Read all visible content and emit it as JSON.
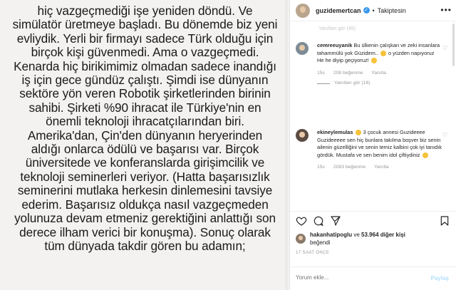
{
  "post": {
    "text_lines": [
      "hiç vazgeçmediği işe yeniden döndü. Ve",
      "simülatör üretmeye başladı. Bu dönemde biz yeni",
      "evliydik. Yerli bir firmayı sadece Türk olduğu için",
      "birçok kişi güvenmedi. Ama o vazgeçmedi.",
      "Kenarda hiç birikimimiz olmadan sadece inandığı",
      "iş için gece gündüz çalıştı. Şimdi ise dünyanın",
      "sektöre yön veren Robotik şirketlerinden birinin",
      "sahibi. Şirketi %90 ihracat ile Türkiye'nin en",
      "önemli teknoloji ihracatçılarından biri.",
      "Amerika'dan, Çin'den dünyanın heryerinden",
      "aldığı onlarca ödülü ve başarısı var. Birçok",
      "üniversitede ve konferanslarda girişimcilik ve",
      "teknoloji seminerleri veriyor. (Hatta başarısızlık",
      "seminerini mutlaka herkesin dinlemesini tavsiye",
      "ederim. Başarısız oldukça nasıl vazgeçmeden",
      "yolunuza devam etmeniz gerektiğini anlattığı son",
      "derece ilham verici bir konuşma). Sonuç olarak",
      "tüm dünyada takdir gören bu adamın;"
    ]
  },
  "header": {
    "username": "guzidemertcan",
    "separator": "•",
    "follow_status": "Takiptesin",
    "more": "•••"
  },
  "comments": {
    "ghost": "Yanıtları gör (45)",
    "items": [
      {
        "user": "cemreeuyanik",
        "text": "Bu ülkenin çalışkan ve zeki insanlara tahammülü yok Güzidem..",
        "text_tail": "o yüzden napıyoruz He he diyip geçiyoruz!",
        "age": "15s",
        "likes": "208 beğenme",
        "reply": "Yanıtla",
        "replies": "Yanıtları gör (16)"
      },
      {
        "user": "ekineylemulas",
        "text": "3 çocuk annesi Guzideeee Guzideeeee sen hiç bunlara takılma boşver biz senin ailenin güzelliğini ve senin temiz kalbini çok iyi tanıdık gördük. Mustafa ve sen benim idol çiftiydiniz",
        "age": "15s",
        "likes": "2083 beğenme",
        "reply": "Yanıtla"
      }
    ]
  },
  "likes": {
    "user": "hakanhatipoglu",
    "connector": "ve",
    "count": "53.964 diğer kişi",
    "suffix": "beğendi"
  },
  "time": "17 SAAT ÖNCE",
  "add_comment": {
    "placeholder": "Yorum ekle...",
    "share": "Paylaş"
  }
}
